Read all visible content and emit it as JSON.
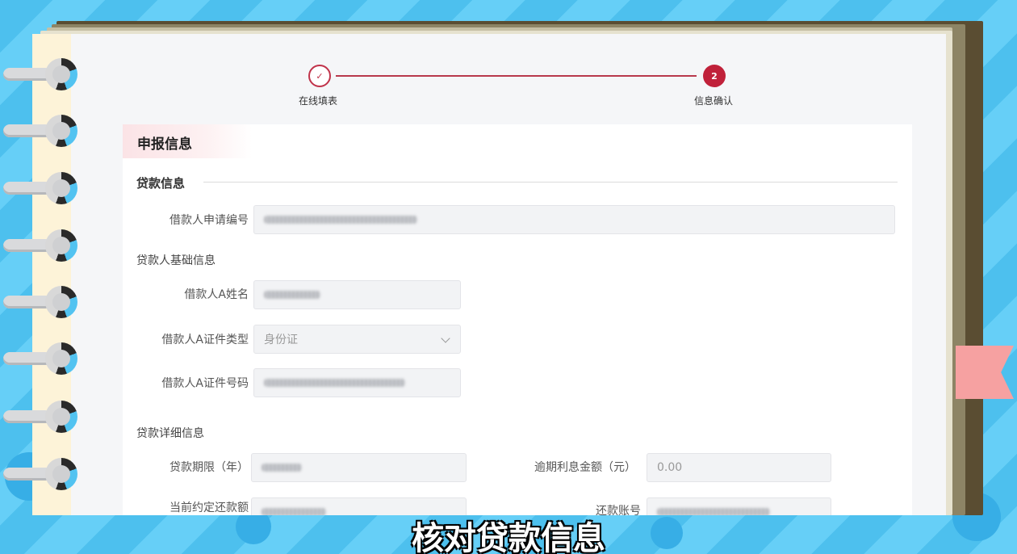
{
  "steps": [
    {
      "label": "在线填表",
      "state": "done",
      "icon": "check-icon"
    },
    {
      "label": "信息确认",
      "number": "2",
      "state": "active"
    }
  ],
  "section": {
    "title": "申报信息",
    "loan_info_title": "贷款信息",
    "application_number_label": "借款人申请编号",
    "basic_info_title": "贷款人基础信息",
    "borrower_name_label": "借款人A姓名",
    "id_type_label": "借款人A证件类型",
    "id_type_value": "身份证",
    "id_number_label": "借款人A证件号码",
    "detail_info_title": "贷款详细信息",
    "loan_term_label": "贷款期限（年）",
    "overdue_interest_label": "逾期利息金额（元）",
    "overdue_interest_value": "0.00",
    "current_repayment_label": "当前约定还款额",
    "repayment_account_label": "还款账号"
  },
  "caption": "核对贷款信息",
  "colors": {
    "accent": "#c0213a",
    "background": "#56c7f3",
    "flag": "#f6a1a1"
  }
}
